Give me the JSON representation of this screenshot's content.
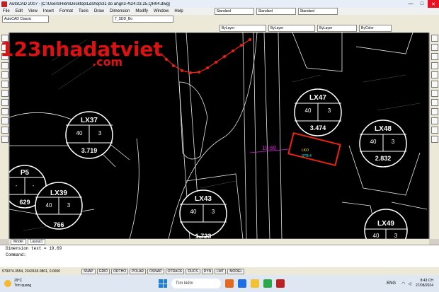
{
  "window": {
    "title": "AutoCAD 2007 - [C:\\Users\\Hiền\\Desktop\\Ldshop\\31 do ar\\gn3-4\\24.03.25.QH04.dwg]",
    "minimize": "—",
    "maximize": "□",
    "close": "✕"
  },
  "menu": [
    "File",
    "Edit",
    "View",
    "Insert",
    "Format",
    "Tools",
    "Draw",
    "Dimension",
    "Modify",
    "Window",
    "Help"
  ],
  "styles": {
    "text_style": "Standard",
    "dim_style": "Standard",
    "table_style": "Standard"
  },
  "workspace": "AutoCAD Classic",
  "layer": "7_SDD_Bo",
  "properties": {
    "color": "ByLayer",
    "linetype": "ByLayer",
    "lineweight": "ByLayer",
    "plotstyle": "ByColor"
  },
  "tabs": [
    "Model",
    "Layout1"
  ],
  "command": {
    "line1": "Dimension text = 19.69",
    "line2": "Command:"
  },
  "status": {
    "coords": "579074.3554, 2343165.9801, 0.0000",
    "buttons": [
      "SNAP",
      "GRID",
      "ORTHO",
      "POLAR",
      "OSNAP",
      "OTRACK",
      "DUCS",
      "DYN",
      "LWT",
      "MODEL"
    ]
  },
  "watermark": {
    "line1": "123nhadatviet",
    "line2": ".com"
  },
  "drawing": {
    "dimension": "19.69",
    "highlight_labels": [
      "LKO",
      "STB.4"
    ],
    "lots": [
      {
        "name": "LX47",
        "a": "40",
        "b": "3",
        "area": "3.474"
      },
      {
        "name": "LX37",
        "a": "40",
        "b": "3",
        "area": "3.719"
      },
      {
        "name": "LX48",
        "a": "40",
        "b": "3",
        "area": "2.832"
      },
      {
        "name": "P5",
        "a": "-",
        "b": "-",
        "area": "629"
      },
      {
        "name": "LX39",
        "a": "40",
        "b": "3",
        "area": "766"
      },
      {
        "name": "LX43",
        "a": "40",
        "b": "3",
        "area": "1.723"
      },
      {
        "name": "LX49",
        "a": "40",
        "b": "3",
        "area": "-"
      }
    ]
  },
  "taskbar": {
    "temp": "29°C",
    "condition": "Trời quang",
    "search": "Tìm kiếm",
    "lang": "ENG",
    "time": "8:43 CH",
    "date": "27/08/2024"
  }
}
